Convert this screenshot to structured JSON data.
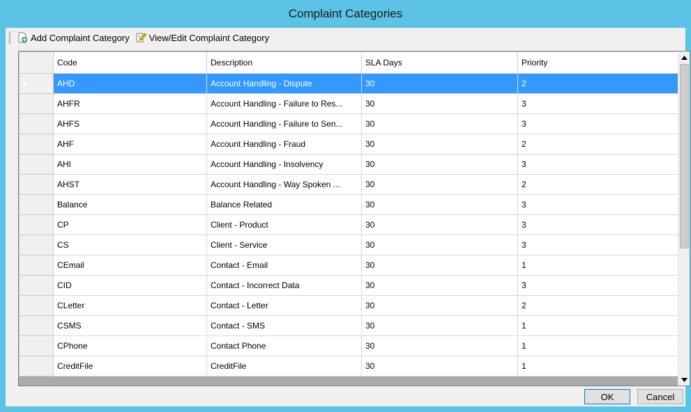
{
  "window": {
    "title": "Complaint Categories"
  },
  "toolbar": {
    "add_label": "Add Complaint Category",
    "edit_label": "View/Edit Complaint Category"
  },
  "grid": {
    "columns": [
      "Code",
      "Description",
      "SLA Days",
      "Priority"
    ],
    "rows": [
      {
        "code": "AHD",
        "description": "Account Handling - Dispute",
        "sla": "30",
        "priority": "2"
      },
      {
        "code": "AHFR",
        "description": "Account Handling - Failure to Res...",
        "sla": "30",
        "priority": "3"
      },
      {
        "code": "AHFS",
        "description": "Account Handling - Failure to Sen...",
        "sla": "30",
        "priority": "3"
      },
      {
        "code": "AHF",
        "description": "Account Handling - Fraud",
        "sla": "30",
        "priority": "2"
      },
      {
        "code": "AHI",
        "description": "Account Handling - Insolvency",
        "sla": "30",
        "priority": "3"
      },
      {
        "code": "AHST",
        "description": "Account Handling - Way Spoken ...",
        "sla": "30",
        "priority": "2"
      },
      {
        "code": "Balance",
        "description": "Balance Related",
        "sla": "30",
        "priority": "3"
      },
      {
        "code": "CP",
        "description": "Client - Product",
        "sla": "30",
        "priority": "3"
      },
      {
        "code": "CS",
        "description": "Client - Service",
        "sla": "30",
        "priority": "3"
      },
      {
        "code": "CEmail",
        "description": "Contact - Email",
        "sla": "30",
        "priority": "1"
      },
      {
        "code": "CID",
        "description": "Contact - Incorrect Data",
        "sla": "30",
        "priority": "3"
      },
      {
        "code": "CLetter",
        "description": "Contact - Letter",
        "sla": "30",
        "priority": "2"
      },
      {
        "code": "CSMS",
        "description": "Contact - SMS",
        "sla": "30",
        "priority": "1"
      },
      {
        "code": "CPhone",
        "description": "Contact Phone",
        "sla": "30",
        "priority": "1"
      },
      {
        "code": "CreditFile",
        "description": "CreditFile",
        "sla": "30",
        "priority": "1"
      }
    ],
    "selected_index": 0
  },
  "buttons": {
    "ok": "OK",
    "cancel": "Cancel"
  },
  "colors": {
    "titlebar": "#5bc3e6",
    "selection": "#3399ff"
  },
  "icons": {
    "add": "add-document-icon",
    "edit": "edit-document-icon"
  }
}
